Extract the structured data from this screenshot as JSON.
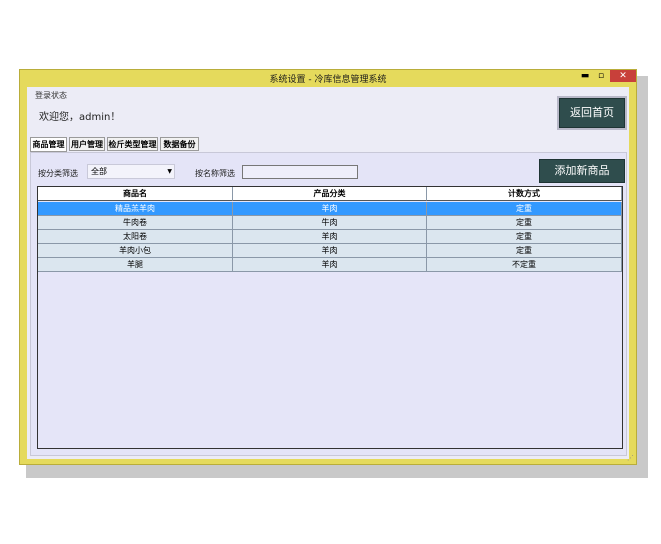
{
  "window": {
    "title": "系统设置 - 冷库信息管理系统",
    "min_glyph": "▬",
    "max_glyph": "▫",
    "close_glyph": "✕"
  },
  "login": {
    "group_label": "登录状态",
    "welcome": "欢迎您，admin！",
    "home_button": "返回首页"
  },
  "tabs": [
    {
      "label": "商品管理"
    },
    {
      "label": "用户管理"
    },
    {
      "label": "检斤类型管理"
    },
    {
      "label": "数据备份"
    }
  ],
  "filters": {
    "category_label": "按分类筛选",
    "category_value": "全部",
    "name_label": "按名称筛选",
    "name_value": ""
  },
  "add_button": "添加新商品",
  "grid": {
    "columns": [
      "商品名",
      "产品分类",
      "计数方式"
    ],
    "rows": [
      [
        "精品羔羊肉",
        "羊肉",
        "定重"
      ],
      [
        "牛肉卷",
        "牛肉",
        "定重"
      ],
      [
        "太阳卷",
        "羊肉",
        "定重"
      ],
      [
        "羊肉小包",
        "羊肉",
        "定重"
      ],
      [
        "羊腿",
        "羊肉",
        "不定重"
      ]
    ],
    "selected_row": 0
  },
  "colors": {
    "window_frame": "#e5da5c",
    "button_dark": "#2f4d4d",
    "selection": "#3399ff",
    "row_bg": "#dbe6ef",
    "close_red": "#c8403a"
  }
}
